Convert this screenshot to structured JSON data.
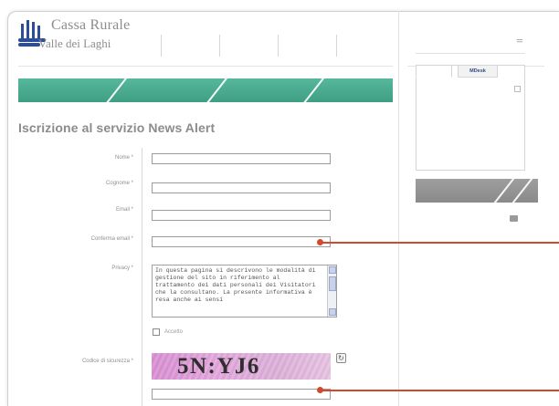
{
  "header": {
    "brand_line1": "Cassa Rurale",
    "brand_line2": "Valle dei Laghi",
    "top_nav": [
      "",
      "",
      "",
      "",
      ""
    ]
  },
  "green_nav": {
    "items": [
      "",
      "",
      "",
      ""
    ]
  },
  "page": {
    "title": "Iscrizione al servizio News Alert"
  },
  "form": {
    "fields": [
      {
        "label": "Nome *",
        "value": ""
      },
      {
        "label": "Cognome *",
        "value": ""
      },
      {
        "label": "Email *",
        "value": ""
      },
      {
        "label": "Conferma email *",
        "value": ""
      }
    ],
    "privacy_label": "Privacy *",
    "privacy_text": "In questa pagina si descrivono le modalità di gestione del sito in riferimento al trattamento dei dati personali dei Visitatori che la consultano. La presente informativa è resa anche ai sensi",
    "accept_label": "Accetto",
    "captcha_label": "Codice di sicurezza *",
    "captcha_text": "5N:YJ6",
    "captcha_input_value": ""
  },
  "sidebar": {
    "search_placeholder": "",
    "tabs": [
      "",
      "MDesk"
    ],
    "link": "",
    "heading": "",
    "body": "",
    "bar_label": "",
    "bottom_text": ""
  },
  "colors": {
    "green_nav": "#4aab8f",
    "annotation": "#d24a2e",
    "brand_blue": "#2c4e9a"
  }
}
